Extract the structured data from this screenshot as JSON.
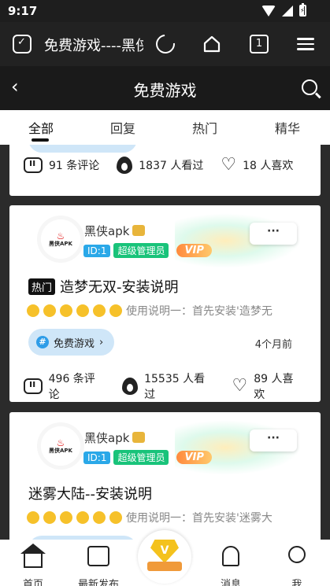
{
  "status_bar": {
    "time": "9:17"
  },
  "browser": {
    "title": "免费游戏----黑侠",
    "tab_count": "1",
    "icons": [
      "shield-check-icon",
      "reload-icon",
      "home-icon",
      "tabs-icon",
      "menu-icon"
    ]
  },
  "header": {
    "title": "免费游戏",
    "back_icon": "chevron-left-icon",
    "search_icon": "search-icon"
  },
  "tabs": [
    {
      "label": "全部",
      "active": true
    },
    {
      "label": "回复",
      "active": false
    },
    {
      "label": "热门",
      "active": false
    },
    {
      "label": "精华",
      "active": false
    }
  ],
  "posts": [
    {
      "stats": {
        "comments": "91 条评论",
        "views": "1837 人看过",
        "likes": "18 人喜欢"
      }
    },
    {
      "author": {
        "name": "黑侠apk",
        "id_badge": "ID:1",
        "role_badge": "超级管理员",
        "vip_badge": "VIP",
        "avatar_text": "黑侠APK"
      },
      "more_label": "···",
      "hot_tag": "热门",
      "title": "造梦无双-安装说明",
      "excerpt": "使用说明一：首先安装'造梦无",
      "topic": "免费游戏",
      "topic_icon": "#",
      "time_ago": "4个月前",
      "stats": {
        "comments": "496 条评论",
        "views": "15535 人看过",
        "likes": "89 人喜欢"
      }
    },
    {
      "author": {
        "name": "黑侠apk",
        "id_badge": "ID:1",
        "role_badge": "超级管理员",
        "vip_badge": "VIP",
        "avatar_text": "黑侠APK"
      },
      "more_label": "···",
      "title": "迷雾大陆--安装说明",
      "excerpt": "使用说明一：首先安装'迷雾大"
    }
  ],
  "bottom_nav": [
    {
      "label": "首页",
      "icon": "home-icon"
    },
    {
      "label": "最新发布",
      "icon": "chat-icon"
    },
    {
      "label": "",
      "icon": "vip-diamond-icon"
    },
    {
      "label": "消息",
      "icon": "bell-icon"
    },
    {
      "label": "我",
      "icon": "profile-icon"
    }
  ],
  "colors": {
    "accent_blue": "#2aa8e8",
    "admin_green": "#19c37a",
    "vip_orange": "#ff8a3d",
    "topic_pill": "#cfe6f8"
  }
}
